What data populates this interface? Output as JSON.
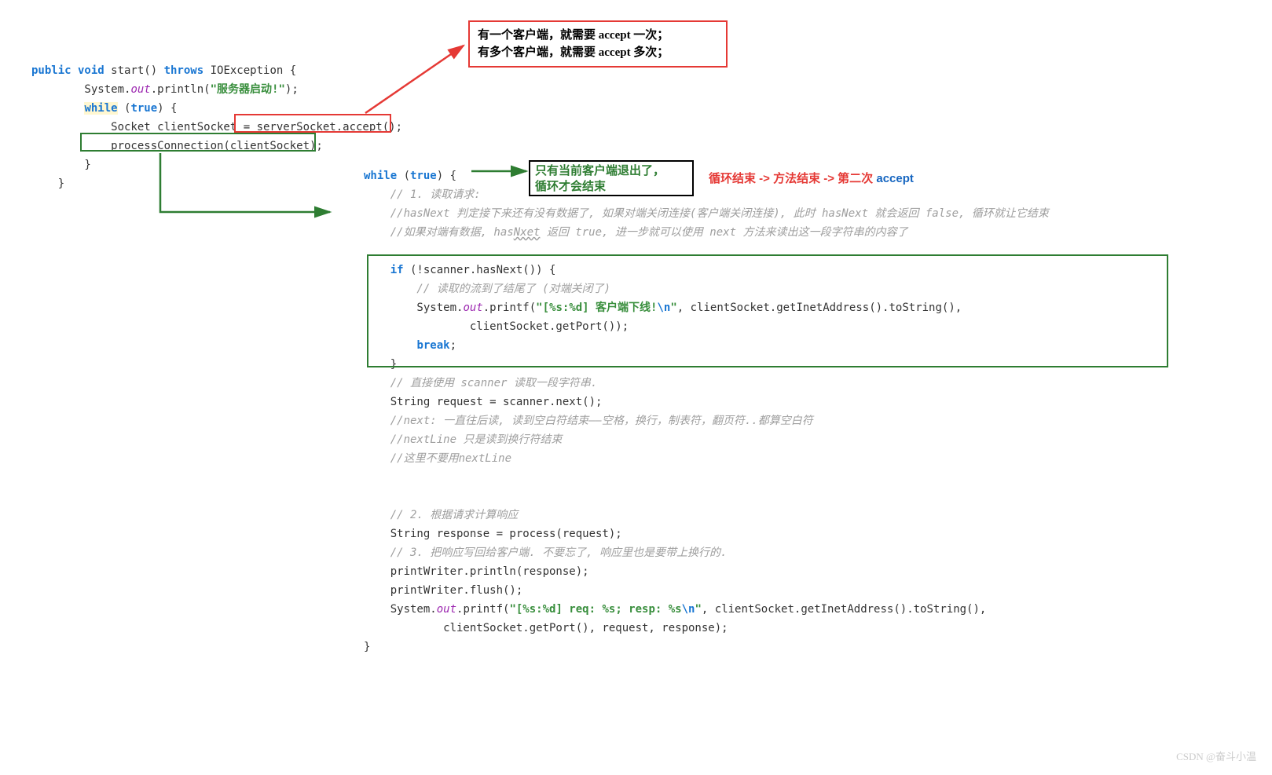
{
  "leftCode": {
    "sig1": "public void",
    "sig2": " start() ",
    "sig3": "throws",
    "sig4": " IOException {",
    "l2a": "        System.",
    "l2b": "out",
    "l2c": ".println(",
    "l2d": "\"服务器启动!\"",
    "l2e": ");",
    "l3a": "        ",
    "l3b": "while",
    "l3c": " (",
    "l3d": "true",
    "l3e": ") {",
    "l4": "            Socket clientSocket = serverSocket.accept();",
    "l5": "            processConnection(clientSocket);",
    "l6": "        }",
    "l7": "    }"
  },
  "rightCode": {
    "r1a": "while",
    "r1b": " (",
    "r1c": "true",
    "r1d": ") {",
    "c1": "    // 1. 读取请求:",
    "c2": "    //hasNext 判定接下来还有没有数据了, 如果对端关闭连接(客户端关闭连接), 此时 hasNext 就会返回 false, 循环就让它结束",
    "c3a": "    //如果对端有数据, has",
    "c3b": "Nxet",
    "c3c": " 返回 true, 进一步就可以使用 next 方法来读出这一段字符串的内容了",
    "r5a": "    if",
    "r5b": " (!scanner.hasNext()) {",
    "c4": "        // 读取的流到了结尾了 (对端关闭了)",
    "r7a": "        System.",
    "r7b": "out",
    "r7c": ".printf(",
    "r7d": "\"[%s:%d] 客户端下线!",
    "r7e": "\\n",
    "r7f": "\"",
    "r7g": ", clientSocket.getInetAddress().toString(),",
    "r8": "                clientSocket.getPort());",
    "r9a": "        ",
    "r9b": "break",
    "r9c": ";",
    "r10": "    }",
    "c5": "    // 直接使用 scanner 读取一段字符串.",
    "r12": "    String request = scanner.next();",
    "c6": "    //next: 一直往后读, 读到空白符结束——空格，换行，制表符，翻页符..都算空白符",
    "c7": "    //nextLine 只是读到换行符结束",
    "c8": "    //这里不要用nextLine",
    "blank": "",
    "c9": "    // 2. 根据请求计算响应",
    "r18": "    String response = process(request);",
    "c10": "    // 3. 把响应写回给客户端. 不要忘了, 响应里也是要带上换行的.",
    "r20": "    printWriter.println(response);",
    "r21": "    printWriter.flush();",
    "r22a": "    System.",
    "r22b": "out",
    "r22c": ".printf(",
    "r22d": "\"[%s:%d] req: %s; resp: %s",
    "r22e": "\\n",
    "r22f": "\"",
    "r22g": ", clientSocket.getInetAddress().toString(),",
    "r23": "            clientSocket.getPort(), request, response);",
    "r24": "}"
  },
  "notes": {
    "redBox1": "有一个客户端，就需要 accept 一次；",
    "redBox2": "有多个客户端，就需要 accept 多次；",
    "greenNote1": "只有当前客户端退出了，",
    "greenNote2": "循环才会结束",
    "flow1": "循环结束 -> 方法结束 -> 第二次 ",
    "flow2": "accept",
    "watermark": "CSDN @奋斗小温"
  }
}
